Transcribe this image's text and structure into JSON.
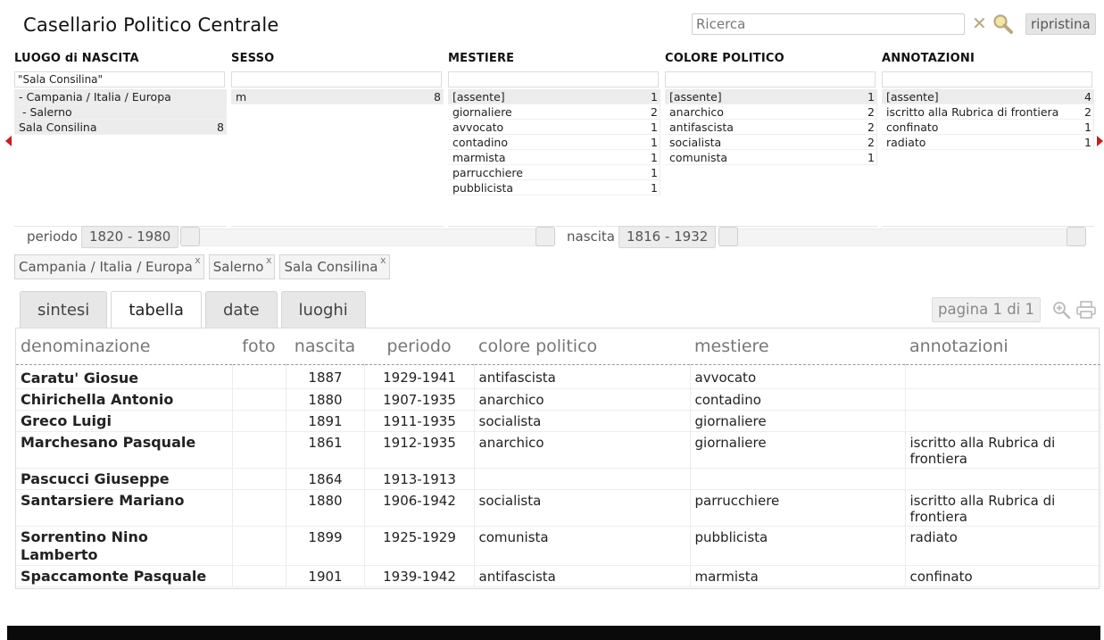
{
  "header": {
    "title": "Casellario Politico Centrale",
    "search_placeholder": "Ricerca",
    "reset_label": "ripristina"
  },
  "facets": [
    {
      "title": "LUOGO di NASCITA",
      "input_value": "\"Sala Consilina\"",
      "items": [
        {
          "label": "- Campania / Italia / Europa",
          "count": ""
        },
        {
          "label": " - Salerno",
          "count": ""
        },
        {
          "label": "Sala Consilina",
          "count": "8"
        }
      ]
    },
    {
      "title": "SESSO",
      "input_value": "",
      "items": [
        {
          "label": "m",
          "count": "8"
        }
      ]
    },
    {
      "title": "MESTIERE",
      "input_value": "",
      "items": [
        {
          "label": "[assente]",
          "count": "1"
        },
        {
          "label": "giornaliere",
          "count": "2"
        },
        {
          "label": "avvocato",
          "count": "1"
        },
        {
          "label": "contadino",
          "count": "1"
        },
        {
          "label": "marmista",
          "count": "1"
        },
        {
          "label": "parrucchiere",
          "count": "1"
        },
        {
          "label": "pubblicista",
          "count": "1"
        }
      ]
    },
    {
      "title": "COLORE POLITICO",
      "input_value": "",
      "items": [
        {
          "label": "[assente]",
          "count": "1"
        },
        {
          "label": "anarchico",
          "count": "2"
        },
        {
          "label": "antifascista",
          "count": "2"
        },
        {
          "label": "socialista",
          "count": "2"
        },
        {
          "label": "comunista",
          "count": "1"
        }
      ]
    },
    {
      "title": "ANNOTAZIONI",
      "input_value": "",
      "items": [
        {
          "label": "[assente]",
          "count": "4"
        },
        {
          "label": "iscritto alla Rubrica di frontiera",
          "count": "2"
        },
        {
          "label": "confinato",
          "count": "1"
        },
        {
          "label": "radiato",
          "count": "1"
        }
      ]
    }
  ],
  "ranges": {
    "periodo": {
      "label": "periodo",
      "value": "1820 - 1980"
    },
    "nascita": {
      "label": "nascita",
      "value": "1816 - 1932"
    }
  },
  "breadcrumbs": [
    "Campania / Italia / Europa",
    "Salerno",
    "Sala Consilina"
  ],
  "breadcrumb_remove": "x",
  "tabs": [
    "sintesi",
    "tabella",
    "date",
    "luoghi"
  ],
  "active_tab": "tabella",
  "pager": "pagina 1 di 1",
  "table": {
    "columns": [
      "denominazione",
      "foto",
      "nascita",
      "periodo",
      "colore politico",
      "mestiere",
      "annotazioni"
    ],
    "rows": [
      {
        "denominazione": "Caratu' Giosue",
        "foto": "",
        "nascita": "1887",
        "periodo": "1929-1941",
        "colore": "antifascista",
        "mestiere": "avvocato",
        "annotazioni": ""
      },
      {
        "denominazione": "Chirichella Antonio",
        "foto": "",
        "nascita": "1880",
        "periodo": "1907-1935",
        "colore": "anarchico",
        "mestiere": "contadino",
        "annotazioni": ""
      },
      {
        "denominazione": "Greco Luigi",
        "foto": "",
        "nascita": "1891",
        "periodo": "1911-1935",
        "colore": "socialista",
        "mestiere": "giornaliere",
        "annotazioni": ""
      },
      {
        "denominazione": "Marchesano Pasquale",
        "foto": "",
        "nascita": "1861",
        "periodo": "1912-1935",
        "colore": "anarchico",
        "mestiere": "giornaliere",
        "annotazioni": "iscritto alla Rubrica di frontiera"
      },
      {
        "denominazione": "Pascucci Giuseppe",
        "foto": "",
        "nascita": "1864",
        "periodo": "1913-1913",
        "colore": "",
        "mestiere": "",
        "annotazioni": ""
      },
      {
        "denominazione": "Santarsiere Mariano",
        "foto": "",
        "nascita": "1880",
        "periodo": "1906-1942",
        "colore": "socialista",
        "mestiere": "parrucchiere",
        "annotazioni": "iscritto alla Rubrica di frontiera"
      },
      {
        "denominazione": "Sorrentino Nino Lamberto",
        "foto": "",
        "nascita": "1899",
        "periodo": "1925-1929",
        "colore": "comunista",
        "mestiere": "pubblicista",
        "annotazioni": "radiato"
      },
      {
        "denominazione": "Spaccamonte Pasquale",
        "foto": "",
        "nascita": "1901",
        "periodo": "1939-1942",
        "colore": "antifascista",
        "mestiere": "marmista",
        "annotazioni": "confinato"
      }
    ]
  },
  "colors": {
    "accent_arrow": "#cc1a1a",
    "icon_tan": "#b8a880"
  }
}
